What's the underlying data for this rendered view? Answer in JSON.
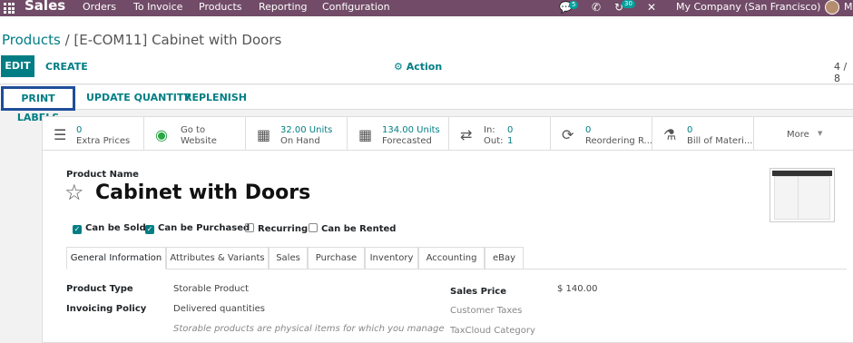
{
  "navbar": {
    "app_name": "Sales",
    "menu": [
      "Orders",
      "To Invoice",
      "Products",
      "Reporting",
      "Configuration"
    ],
    "chat_badge": "5",
    "activity_badge": "30",
    "company": "My Company (San Francisco)",
    "user_initial": "M"
  },
  "breadcrumb": {
    "parent": "Products",
    "separator": "/",
    "current": "[E-COM11] Cabinet with Doors"
  },
  "toolbar": {
    "edit": "EDIT",
    "create": "CREATE",
    "action": "Action",
    "pager": "4 / 8"
  },
  "header_buttons": {
    "print_labels": "PRINT LABELS",
    "update_quantity": "UPDATE QUANTITY",
    "replenish": "REPLENISH"
  },
  "smart_buttons": {
    "extra_prices": {
      "value": "0",
      "label": "Extra Prices"
    },
    "website": {
      "line1": "Go to",
      "line2": "Website"
    },
    "on_hand": {
      "value": "32.00 Units",
      "label": "On Hand"
    },
    "forecasted": {
      "value": "134.00 Units",
      "label": "Forecasted"
    },
    "moves": {
      "in_label": "In:",
      "in_value": "0",
      "out_label": "Out:",
      "out_value": "1"
    },
    "reordering": {
      "value": "0",
      "label": "Reordering R..."
    },
    "bom": {
      "value": "0",
      "label": "Bill of Materi..."
    },
    "more": "More"
  },
  "product": {
    "name_label": "Product Name",
    "name": "Cabinet with Doors",
    "checkboxes": [
      {
        "label": "Can be Sold",
        "checked": true
      },
      {
        "label": "Can be Purchased",
        "checked": true
      },
      {
        "label": "Recurring",
        "checked": false
      },
      {
        "label": "Can be Rented",
        "checked": false
      }
    ]
  },
  "tabs": [
    "General Information",
    "Attributes & Variants",
    "Sales",
    "Purchase",
    "Inventory",
    "Accounting",
    "eBay"
  ],
  "general": {
    "product_type_label": "Product Type",
    "product_type": "Storable Product",
    "invoicing_policy_label": "Invoicing Policy",
    "invoicing_policy": "Delivered quantities",
    "note": "Storable products are physical items for which you manage",
    "sales_price_label": "Sales Price",
    "sales_price": "$ 140.00",
    "customer_taxes_label": "Customer Taxes",
    "taxcloud_label": "TaxCloud Category"
  },
  "colors": {
    "navbar": "#714b67",
    "accent": "#017e84",
    "focus_outline": "#1f4e99"
  }
}
